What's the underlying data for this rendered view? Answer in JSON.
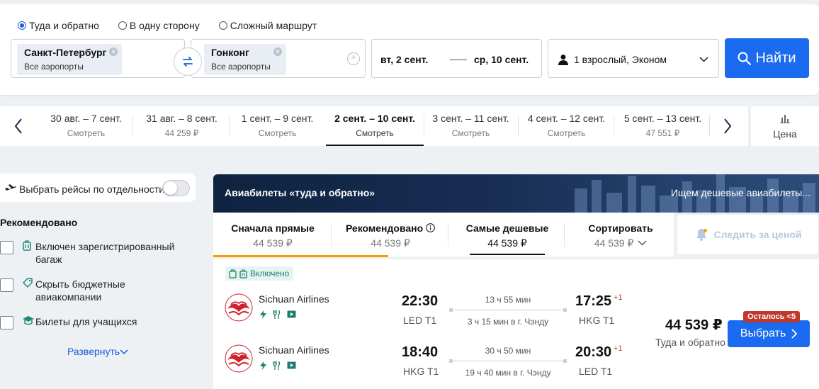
{
  "search": {
    "trip_types": [
      {
        "label": "Туда и обратно",
        "selected": true
      },
      {
        "label": "В одну сторону",
        "selected": false
      },
      {
        "label": "Сложный маршрут",
        "selected": false
      }
    ],
    "origin": {
      "city": "Санкт-Петербург",
      "airports": "Все аэропорты"
    },
    "destination": {
      "city": "Гонконг",
      "airports": "Все аэропорты"
    },
    "depart_date": "вт, 2 сент.",
    "return_date": "ср, 10 сент.",
    "passengers": "1 взрослый, Эконом",
    "find_label": "Найти"
  },
  "date_strip": {
    "cells": [
      {
        "range": "30 авг. – 7 сент.",
        "price": "Смотреть",
        "active": false
      },
      {
        "range": "31 авг. – 8 сент.",
        "price": "44 259 ₽",
        "active": false
      },
      {
        "range": "1 сент. – 9 сент.",
        "price": "Смотреть",
        "active": false
      },
      {
        "range": "2 сент. – 10 сент.",
        "price": "Смотреть",
        "active": true
      },
      {
        "range": "3 сент. – 11 сент.",
        "price": "Смотреть",
        "active": false
      },
      {
        "range": "4 сент. – 12 сент.",
        "price": "Смотреть",
        "active": false
      },
      {
        "range": "5 сент. – 13 сент.",
        "price": "47 551 ₽",
        "active": false
      }
    ],
    "price_toggle_label": "Цена"
  },
  "sidebar": {
    "separate_flights_label": "Выбрать рейсы по отдельности",
    "separate_flights_on": false,
    "filter_title": "Рекомендовано",
    "filters": [
      {
        "label": "Включен зарегистрированный багаж",
        "icon": "luggage-icon",
        "checked": false
      },
      {
        "label": "Скрыть бюджетные авиакомпании",
        "icon": "tag-icon",
        "checked": false
      },
      {
        "label": "Билеты для учащихся",
        "icon": "graduation-cap-icon",
        "checked": false
      }
    ],
    "expand_label": "Развернуть"
  },
  "results": {
    "banner_title": "Авиабилеты «туда и обратно»",
    "banner_note": "Ищем дешевые авиабилеты...",
    "sort_tabs": [
      {
        "label": "Сначала прямые",
        "price": "44 539 ₽"
      },
      {
        "label": "Рекомендовано",
        "price": "44 539 ₽"
      },
      {
        "label": "Самые дешевые",
        "price": "44 539 ₽"
      },
      {
        "label": "Сортировать",
        "price": "44 539 ₽"
      }
    ],
    "watch_price_label": "Следить за ценой",
    "ticket": {
      "badge": "Включено",
      "outbound": {
        "airline": "Sichuan Airlines",
        "dep_time": "22:30",
        "dep_airport": "LED T1",
        "duration": "13 ч 55 мин",
        "stopover": "3 ч 15 мин в г. Чэнду",
        "arr_time": "17:25",
        "arr_plus": "+1",
        "arr_airport": "HKG T1"
      },
      "inbound": {
        "airline": "Sichuan Airlines",
        "dep_time": "18:40",
        "dep_airport": "HKG T1",
        "duration": "30 ч 50 мин",
        "stopover": "19 ч 40 мин в г. Чэнду",
        "arr_time": "20:30",
        "arr_plus": "+1",
        "arr_airport": "LED T1"
      },
      "price": "44 539 ₽",
      "price_note": "Туда и обратно",
      "seats_left": "Осталось <5",
      "select_label": "Выбрать"
    }
  },
  "colors": {
    "accent": "#1a6bf0",
    "brand_dark": "#0f2240",
    "sort_highlight": "#f5a000",
    "warning": "#c0392b",
    "included": "#1f7f6f"
  }
}
